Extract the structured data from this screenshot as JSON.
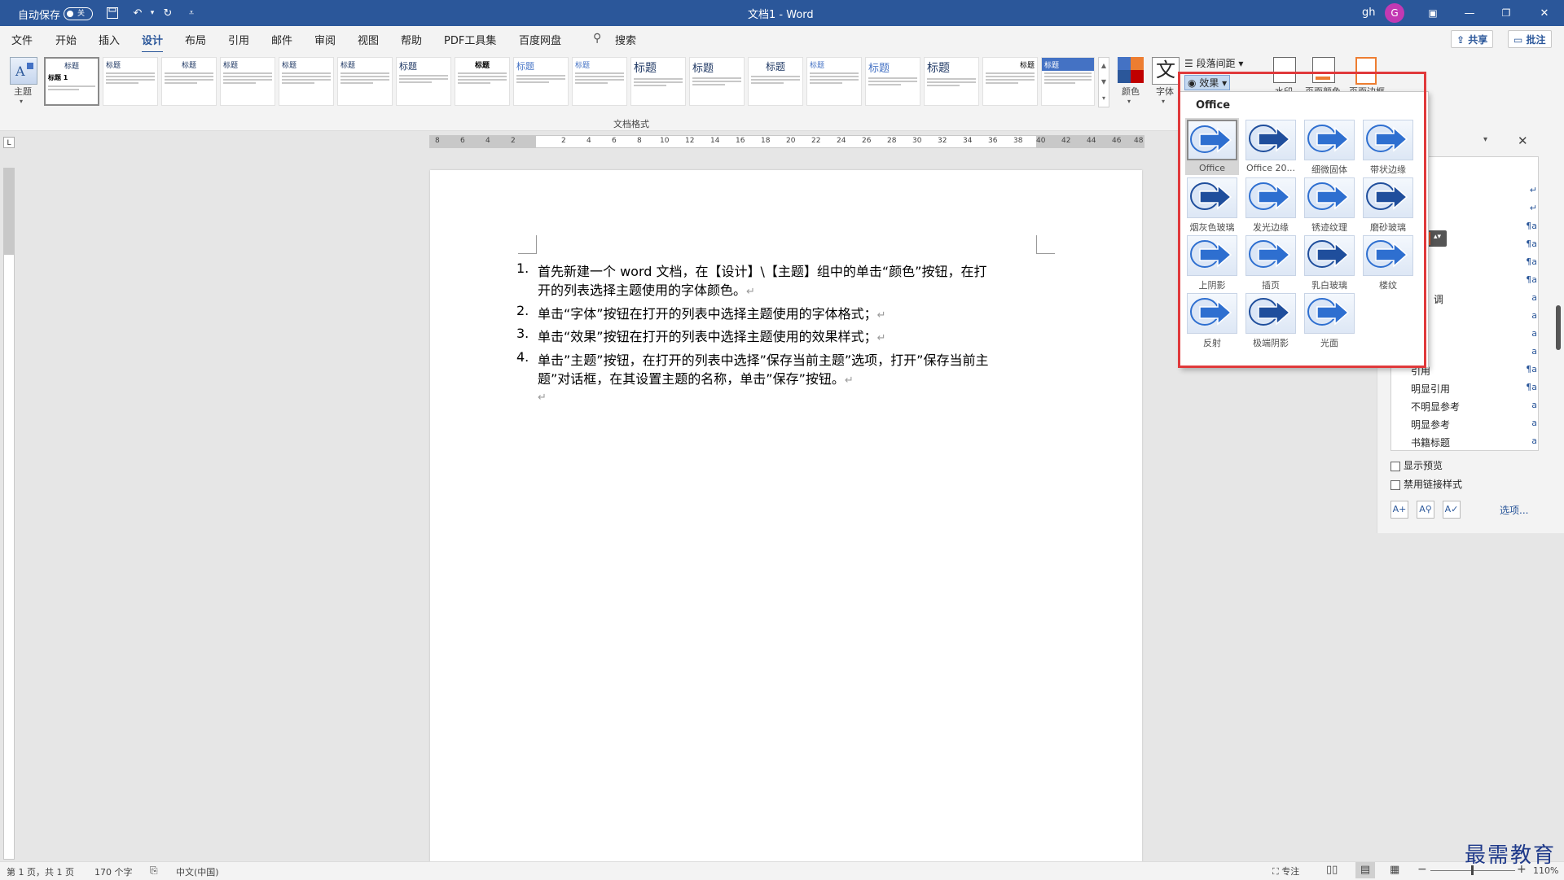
{
  "titlebar": {
    "autosave_label": "自动保存",
    "autosave_state": "关",
    "doc_title": "文档1 - Word",
    "user_initials": "gh",
    "avatar_letter": "G"
  },
  "tabs": [
    "文件",
    "开始",
    "插入",
    "设计",
    "布局",
    "引用",
    "邮件",
    "审阅",
    "视图",
    "帮助",
    "PDF工具集",
    "百度网盘"
  ],
  "active_tab": "设计",
  "search_label": "搜索",
  "share_label": "共享",
  "comment_label": "批注",
  "ribbon": {
    "theme_label": "主题",
    "gallery_group_label": "文档格式",
    "gallery_titles": [
      "标题",
      "标题",
      "标题",
      "标题",
      "标题",
      "标题",
      "标题",
      "标题",
      "标题",
      "标题",
      "标题",
      "标题",
      "标题",
      "标题",
      "标题",
      "标题",
      "标题",
      "标题"
    ],
    "first_gallery_text": "标题 1",
    "colors_label": "颜色",
    "fonts_label": "字体",
    "fonts_glyph": "文",
    "paragraph_spacing_label": "段落间距",
    "effects_label": "效果",
    "watermark_label": "水印",
    "page_color_label": "页面颜色",
    "page_border_label": "页面边框"
  },
  "ruler_numbers": [
    "8",
    "6",
    "4",
    "2",
    "2",
    "4",
    "6",
    "8",
    "10",
    "12",
    "14",
    "16",
    "18",
    "20",
    "22",
    "24",
    "26",
    "28",
    "30",
    "32",
    "34",
    "36",
    "38",
    "40",
    "42",
    "44",
    "46",
    "48"
  ],
  "document": {
    "items": [
      {
        "num": "1.",
        "lines": [
          "首先新建一个 word 文档，在【设计】\\【主题】组中的单击“颜色”按钮，在打",
          "开的列表选择主题使用的字体颜色。"
        ]
      },
      {
        "num": "2.",
        "lines": [
          "单击“字体”按钮在打开的列表中选择主题使用的字体格式；"
        ]
      },
      {
        "num": "3.",
        "lines": [
          "单击“效果”按钮在打开的列表中选择主题使用的效果样式；"
        ]
      },
      {
        "num": "4.",
        "lines": [
          "单击”主题”按钮，在打开的列表中选择”保存当前主题”选项，打开”保存当前主",
          "题”对话框，在其设置主题的名称，单击”保存”按钮。"
        ]
      }
    ],
    "pilcrow": "↵"
  },
  "effects_panel": {
    "heading": "Office",
    "items": [
      "Office",
      "Office 20...",
      "细微固体",
      "带状边缘",
      "烟灰色玻璃",
      "发光边缘",
      "锈迹纹理",
      "磨砂玻璃",
      "上阴影",
      "插页",
      "乳白玻璃",
      "楼纹",
      "反射",
      "极端阴影",
      "光面"
    ],
    "selected": "Office"
  },
  "styles_pane": {
    "rows": [
      {
        "name": "",
        "mark": "↵"
      },
      {
        "name": "",
        "mark": "↵"
      },
      {
        "name": "",
        "mark": "¶a"
      },
      {
        "name": "",
        "mark": "¶a"
      },
      {
        "name": "",
        "mark": "¶a"
      },
      {
        "name": "",
        "mark": "¶a"
      },
      {
        "name": "调",
        "mark": "a"
      },
      {
        "name": "",
        "mark": "a"
      },
      {
        "name": "",
        "mark": "a"
      },
      {
        "name": "",
        "mark": "a"
      },
      {
        "name": "引用",
        "mark": "¶a"
      },
      {
        "name": "明显引用",
        "mark": "¶a"
      },
      {
        "name": "不明显参考",
        "mark": "a"
      },
      {
        "name": "明显参考",
        "mark": "a"
      },
      {
        "name": "书籍标题",
        "mark": "a"
      }
    ],
    "show_preview": "显示预览",
    "disable_linked": "禁用链接样式",
    "options": "选项..."
  },
  "statusbar": {
    "page": "第 1 页，共 1 页",
    "words": "170 个字",
    "language": "中文(中国)",
    "focus": "专注",
    "zoom": "110%"
  },
  "watermark_text": "最需教育"
}
